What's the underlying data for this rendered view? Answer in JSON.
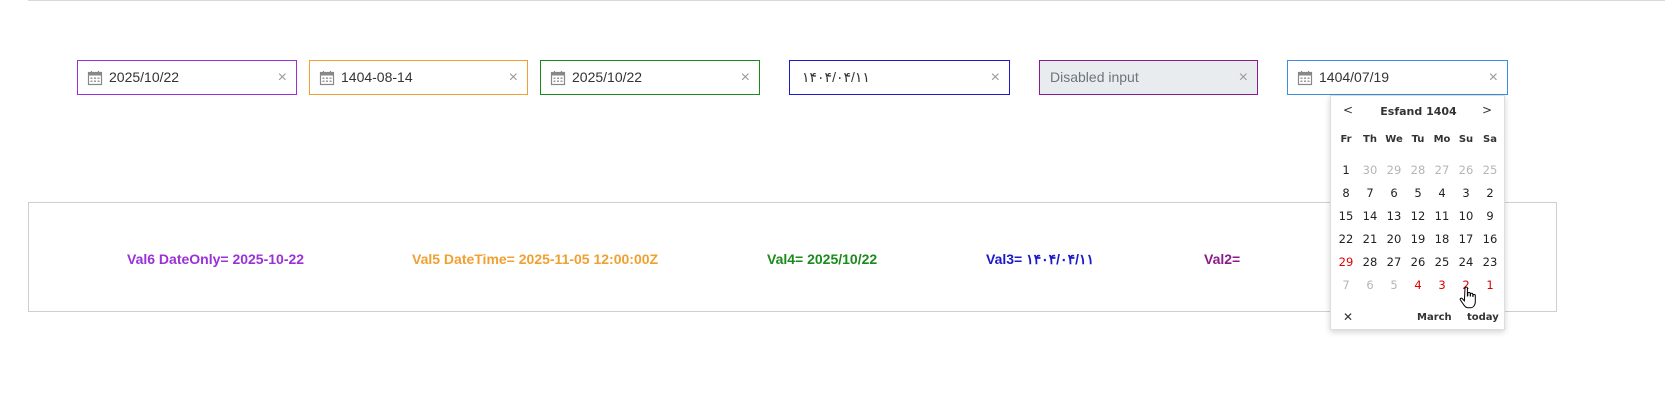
{
  "inputs": [
    {
      "value": "2025/10/22",
      "border": "#9b30d9",
      "icon": "calendar-icon"
    },
    {
      "value": "1404-08-14",
      "border": "#f0a030",
      "icon": "calendar-icon"
    },
    {
      "value": "2025/10/22",
      "border": "#1a8a1a",
      "icon": "calendar-icon"
    },
    {
      "value": "۱۴۰۴/۰۴/۱۱",
      "border": "#1a1acc",
      "icon": ""
    },
    {
      "value": "Disabled input",
      "border": "#8b1a8b",
      "icon": ""
    },
    {
      "value": "1404/07/19",
      "border": "#3d8fe0",
      "icon": "calendar-icon"
    }
  ],
  "clear_symbol": "×",
  "values": {
    "val6": {
      "text": "Val6 DateOnly= 2025-10-22",
      "color": "#9b30d9"
    },
    "val5": {
      "text": "Val5 DateTime= 2025-11-05 12:00:00Z",
      "color": "#f0a030"
    },
    "val4": {
      "text": "Val4= 2025/10/22",
      "color": "#1a8a1a"
    },
    "val3": {
      "text": "Val3= ۱۴۰۴/۰۴/۱۱",
      "color": "#1a1acc"
    },
    "val2": {
      "text": "Val2=",
      "color": "#8b1a8b"
    }
  },
  "picker": {
    "prev": "<",
    "next": ">",
    "title": "Esfand 1404",
    "weekdays": [
      "Fr",
      "Th",
      "We",
      "Tu",
      "Mo",
      "Su",
      "Sa"
    ],
    "weeks": [
      [
        {
          "d": "1"
        },
        {
          "d": "30",
          "s": "muted"
        },
        {
          "d": "29",
          "s": "muted"
        },
        {
          "d": "28",
          "s": "muted"
        },
        {
          "d": "27",
          "s": "muted"
        },
        {
          "d": "26",
          "s": "muted"
        },
        {
          "d": "25",
          "s": "muted"
        }
      ],
      [
        {
          "d": "8"
        },
        {
          "d": "7"
        },
        {
          "d": "6"
        },
        {
          "d": "5"
        },
        {
          "d": "4"
        },
        {
          "d": "3"
        },
        {
          "d": "2"
        }
      ],
      [
        {
          "d": "15"
        },
        {
          "d": "14"
        },
        {
          "d": "13"
        },
        {
          "d": "12"
        },
        {
          "d": "11"
        },
        {
          "d": "10"
        },
        {
          "d": "9"
        }
      ],
      [
        {
          "d": "22"
        },
        {
          "d": "21"
        },
        {
          "d": "20"
        },
        {
          "d": "19"
        },
        {
          "d": "18"
        },
        {
          "d": "17"
        },
        {
          "d": "16"
        }
      ],
      [
        {
          "d": "29",
          "s": "red"
        },
        {
          "d": "28"
        },
        {
          "d": "27"
        },
        {
          "d": "26"
        },
        {
          "d": "25"
        },
        {
          "d": "24"
        },
        {
          "d": "23"
        }
      ],
      [
        {
          "d": "7",
          "s": "muted"
        },
        {
          "d": "6",
          "s": "muted"
        },
        {
          "d": "5",
          "s": "muted"
        },
        {
          "d": "4",
          "s": "red"
        },
        {
          "d": "3",
          "s": "red"
        },
        {
          "d": "2",
          "s": "red"
        },
        {
          "d": "1",
          "s": "red"
        }
      ]
    ],
    "close": "✕",
    "month_link": "March",
    "today": "today"
  }
}
